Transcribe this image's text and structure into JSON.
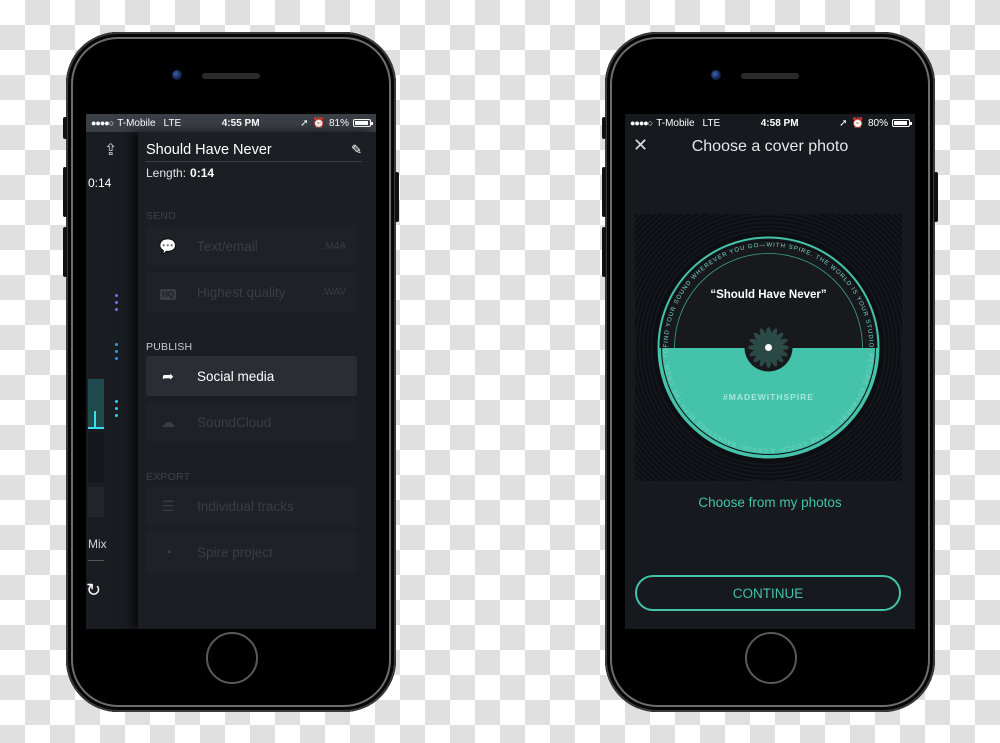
{
  "background": "transparency-checkerboard",
  "colors": {
    "accent": "#44c2aa",
    "screen_bg": "#16191e",
    "drawer_bg": "#1b1e23",
    "active_item_bg": "#2a2d33"
  },
  "left_phone": {
    "status_bar": {
      "signal": "●●●●○",
      "carrier": "T-Mobile",
      "network": "LTE",
      "time": "4:55 PM",
      "battery": "81%",
      "icons": [
        "location-arrow-icon",
        "alarm-icon",
        "battery-icon"
      ]
    },
    "mixer": {
      "share_icon": "share-icon",
      "time_fragment": "0:14",
      "mix_label": "Mix",
      "undo_icon": "redo-circular-arrow-icon",
      "track_dot_colors": [
        "#7b6fe0",
        "#3f8ff0",
        "#2fd0e8"
      ]
    },
    "drawer": {
      "title": "Should Have Never",
      "edit_icon": "pencil-icon",
      "length_label": "Length:",
      "length_value": "0:14",
      "sections": [
        {
          "label": "SEND",
          "items": [
            {
              "icon": "speech-bubble-icon",
              "label": "Text/email",
              "ext": ".M4A",
              "active": false
            },
            {
              "icon": "hq-icon",
              "label": "Highest quality",
              "ext": ".WAV",
              "active": false
            }
          ]
        },
        {
          "label": "PUBLISH",
          "items": [
            {
              "icon": "share-arrow-icon",
              "label": "Social media",
              "ext": "",
              "active": true
            },
            {
              "icon": "soundcloud-icon",
              "label": "SoundCloud",
              "ext": "",
              "active": false
            }
          ]
        },
        {
          "label": "EXPORT",
          "items": [
            {
              "icon": "tracks-icon",
              "label": "Individual tracks",
              "ext": "",
              "active": false
            },
            {
              "icon": "spire-icon",
              "label": "Spire project",
              "ext": "",
              "active": false
            }
          ]
        }
      ]
    }
  },
  "right_phone": {
    "status_bar": {
      "signal": "●●●●○",
      "carrier": "T-Mobile",
      "network": "LTE",
      "time": "4:58 PM",
      "battery": "80%",
      "icons": [
        "location-arrow-icon",
        "alarm-icon",
        "battery-icon"
      ]
    },
    "header": {
      "close_icon": "close-icon",
      "title": "Choose a cover photo"
    },
    "cover": {
      "song_title": "“Should Have Never”",
      "hashtag": "#MADEWITHSPIRE",
      "ring_text": "FIND YOUR SOUND WHEREVER YOU GO—WITH SPIRE. THE WORLD IS YOUR STUDIO. RECORD ANYWHERE: ON THE COUCH, A CANOE, BACKSTAGE WITH THE CREW, YOUR BEDROOM, BATHROOM, HOTEL ROOM. WHO KNEW?"
    },
    "choose_link": "Choose from my photos",
    "continue_button": "CONTINUE"
  }
}
